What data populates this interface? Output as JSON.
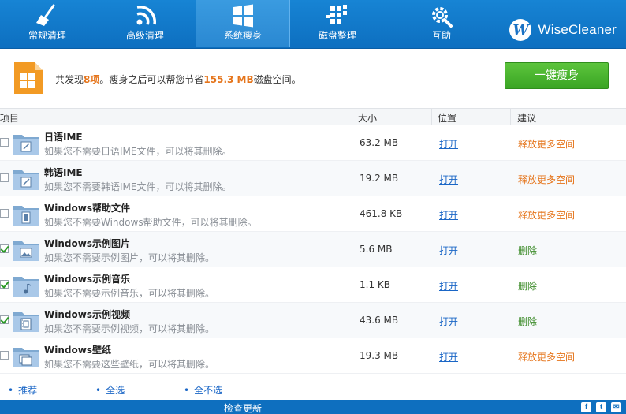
{
  "nav": {
    "tabs": [
      {
        "label": "常规清理",
        "icon": "broom-icon"
      },
      {
        "label": "高级清理",
        "icon": "rss-icon"
      },
      {
        "label": "系统瘦身",
        "icon": "windows-icon"
      },
      {
        "label": "磁盘整理",
        "icon": "disk-defrag-icon"
      },
      {
        "label": "互助",
        "icon": "gear-wrench-icon"
      }
    ],
    "active_tab": "系统瘦身"
  },
  "brand": {
    "logo_letter": "W",
    "name": "WiseCleaner"
  },
  "summary": {
    "prefix": "共发现",
    "count": "8项",
    "middle": "。瘦身之后可以帮您节省",
    "saved": "155.3 MB",
    "suffix": "磁盘空间。",
    "button_label": "一键瘦身"
  },
  "table": {
    "headers": {
      "item": "项目",
      "size": "大小",
      "location": "位置",
      "suggestion": "建议"
    },
    "rows": [
      {
        "name": "日语IME",
        "desc": "如果您不需要日语IME文件，可以将其删除。",
        "size": "63.2 MB",
        "open": "打开",
        "suggestion": "释放更多空间",
        "checked": false,
        "icon": "edit-folder-icon"
      },
      {
        "name": "韩语IME",
        "desc": "如果您不需要韩语IME文件，可以将其删除。",
        "size": "19.2 MB",
        "open": "打开",
        "suggestion": "释放更多空间",
        "checked": false,
        "icon": "edit-folder-icon"
      },
      {
        "name": "Windows帮助文件",
        "desc": "如果您不需要Windows帮助文件，可以将其删除。",
        "size": "461.8 KB",
        "open": "打开",
        "suggestion": "释放更多空间",
        "checked": false,
        "icon": "help-file-folder-icon"
      },
      {
        "name": "Windows示例图片",
        "desc": "如果您不需要示例图片，可以将其删除。",
        "size": "5.6 MB",
        "open": "打开",
        "suggestion": "删除",
        "checked": true,
        "icon": "picture-folder-icon"
      },
      {
        "name": "Windows示例音乐",
        "desc": "如果您不需要示例音乐，可以将其删除。",
        "size": "1.1 KB",
        "open": "打开",
        "suggestion": "删除",
        "checked": true,
        "icon": "music-folder-icon"
      },
      {
        "name": "Windows示例视频",
        "desc": "如果您不需要示例视频，可以将其删除。",
        "size": "43.6 MB",
        "open": "打开",
        "suggestion": "删除",
        "checked": true,
        "icon": "video-folder-icon"
      },
      {
        "name": "Windows壁纸",
        "desc": "如果您不需要这些壁纸，可以将其删除。",
        "size": "19.3 MB",
        "open": "打开",
        "suggestion": "释放更多空间",
        "checked": false,
        "icon": "wallpaper-folder-icon"
      }
    ]
  },
  "colors": {
    "suggest_orange": "#e5741a",
    "suggest_green": "#3f8d2c",
    "link_blue": "#1a66c6",
    "nav_blue": "#1478c9"
  },
  "bottom": {
    "recommend": "推荐",
    "select_all": "全选",
    "select_none": "全不选"
  },
  "status": {
    "update": "检查更新",
    "social": [
      "f",
      "t",
      "✉"
    ]
  }
}
